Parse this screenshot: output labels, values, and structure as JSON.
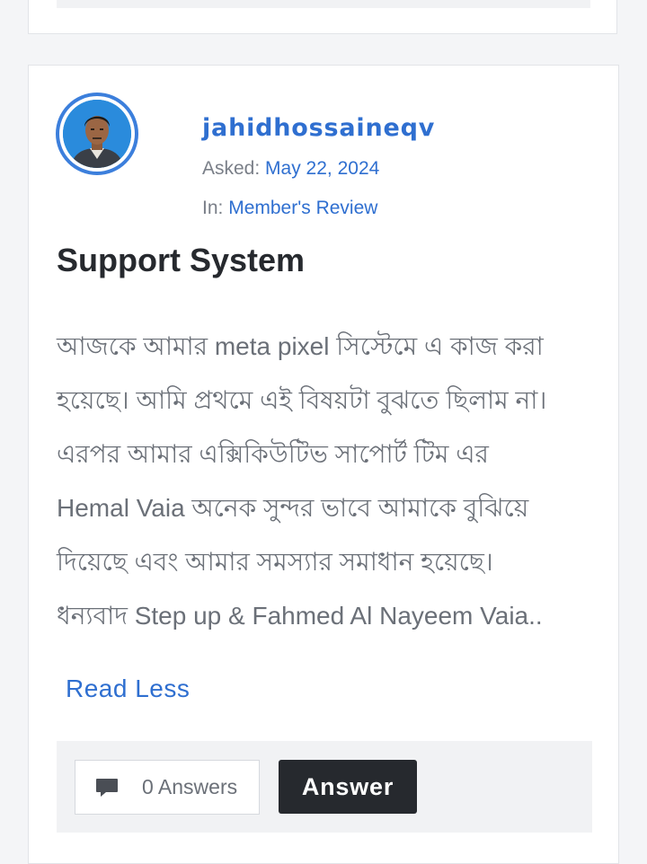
{
  "question": {
    "author": "jahidhossaineqv",
    "asked_label": "Asked:",
    "asked_date": "May 22, 2024",
    "category_label": "In:",
    "category": "Member's Review",
    "title": "Support System",
    "body": "আজকে আমার meta pixel সিস্টেমে এ কাজ করা\nহয়েছে। আমি প্রথমে এই বিষয়টা বুঝতে ছিলাম না।\nএরপর আমার এক্সিকিউটিভ সাপোর্ট টিম এর\nHemal Vaia অনেক সুন্দর ভাবে আমাকে বুঝিয়ে\nদিয়েছে এবং আমার সমস্যার সমাধান হয়েছে।\nধন্যবাদ Step up & Fahmed Al Nayeem Vaia..",
    "read_less": "Read Less",
    "answers_count": "0 Answers",
    "answer_button": "Answer"
  },
  "colors": {
    "accent": "#2f6fd0",
    "dark_button": "#26292e",
    "footer_bg": "#f1f2f4"
  },
  "icons": {
    "answers": "comment-icon",
    "avatar": "avatar"
  }
}
